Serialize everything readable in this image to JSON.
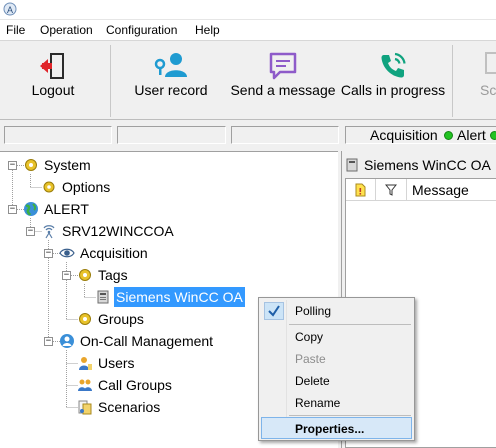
{
  "menu": [
    "File",
    "Operation",
    "Configuration",
    "Help"
  ],
  "toolbar": {
    "logout": "Logout",
    "user_record": "User record",
    "send_message": "Send a message",
    "calls_in_progress": "Calls in progress",
    "partial": "Sc"
  },
  "status": {
    "acquisition": "Acquisition",
    "alert": "Alert",
    "partial_letter": "("
  },
  "tree": {
    "system": "System",
    "options": "Options",
    "alert": "ALERT",
    "server": "SRV12WINCCOA",
    "acquisition": "Acquisition",
    "tags": "Tags",
    "driver": "Siemens WinCC OA",
    "groups": "Groups",
    "oncall": "On-Call Management",
    "users": "Users",
    "call_groups": "Call Groups",
    "scenarios": "Scenarios"
  },
  "right_pane": {
    "title": "Siemens WinCC OA",
    "column_message": "Message"
  },
  "context_menu": {
    "polling": "Polling",
    "copy": "Copy",
    "paste": "Paste",
    "delete": "Delete",
    "rename": "Rename",
    "properties": "Properties..."
  },
  "colors": {
    "selection": "#3399ff",
    "status_green": "#22c322",
    "logout_red": "#e0252a",
    "teal": "#1f9bd1",
    "purple": "#8e5bc9",
    "green_phone": "#10a37f"
  }
}
